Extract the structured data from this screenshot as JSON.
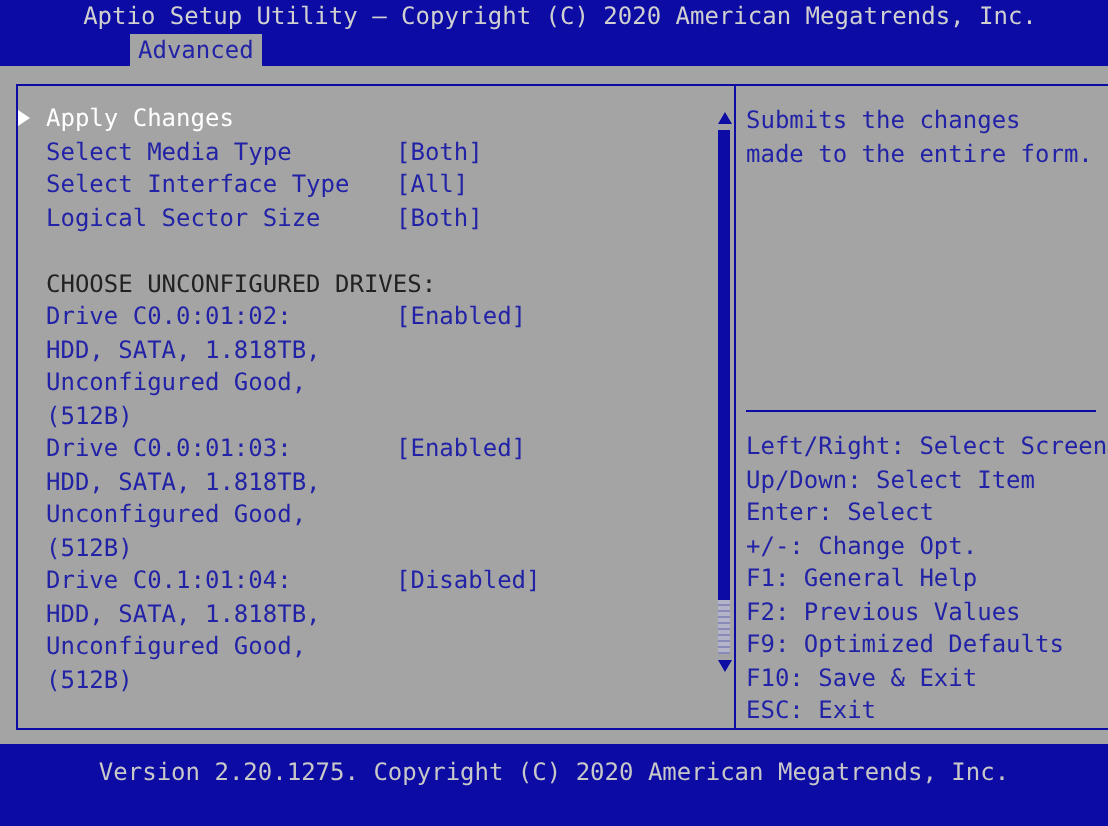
{
  "header": {
    "title": "Aptio Setup Utility – Copyright (C) 2020 American Megatrends, Inc."
  },
  "tabs": [
    {
      "label": "Advanced",
      "selected": true
    }
  ],
  "rows": [
    {
      "kind": "submenu",
      "label": "Apply Changes",
      "selected": true
    },
    {
      "kind": "option",
      "label": "Select Media Type",
      "value": "[Both]",
      "selected": false
    },
    {
      "kind": "option",
      "label": "Select Interface Type",
      "value": "[All]",
      "selected": false
    },
    {
      "kind": "option",
      "label": "Logical Sector Size",
      "value": "[Both]",
      "selected": false
    },
    {
      "kind": "spacer"
    },
    {
      "kind": "heading",
      "label": "CHOOSE UNCONFIGURED DRIVES:"
    },
    {
      "kind": "option",
      "label": "Drive C0.0:01:02:",
      "value": "[Enabled]",
      "selected": false
    },
    {
      "kind": "info",
      "label": "HDD, SATA, 1.818TB,"
    },
    {
      "kind": "info",
      "label": "Unconfigured Good,"
    },
    {
      "kind": "info",
      "label": "(512B)"
    },
    {
      "kind": "option",
      "label": "Drive C0.0:01:03:",
      "value": "[Enabled]",
      "selected": false
    },
    {
      "kind": "info",
      "label": "HDD, SATA, 1.818TB,"
    },
    {
      "kind": "info",
      "label": "Unconfigured Good,"
    },
    {
      "kind": "info",
      "label": "(512B)"
    },
    {
      "kind": "option",
      "label": "Drive C0.1:01:04:",
      "value": "[Disabled]",
      "selected": false
    },
    {
      "kind": "info",
      "label": "HDD, SATA, 1.818TB,"
    },
    {
      "kind": "info",
      "label": "Unconfigured Good,"
    },
    {
      "kind": "info",
      "label": "(512B)"
    }
  ],
  "help": {
    "lines": [
      "Submits the changes",
      "made to the entire form."
    ]
  },
  "keys": [
    "Left/Right: Select Screen",
    "Up/Down: Select Item",
    "Enter: Select",
    "+/-: Change Opt.",
    "F1: General Help",
    "F2: Previous Values",
    "F9: Optimized Defaults",
    "F10: Save & Exit",
    "ESC: Exit"
  ],
  "footer": {
    "text": "Version 2.20.1275. Copyright (C) 2020 American Megatrends, Inc."
  }
}
